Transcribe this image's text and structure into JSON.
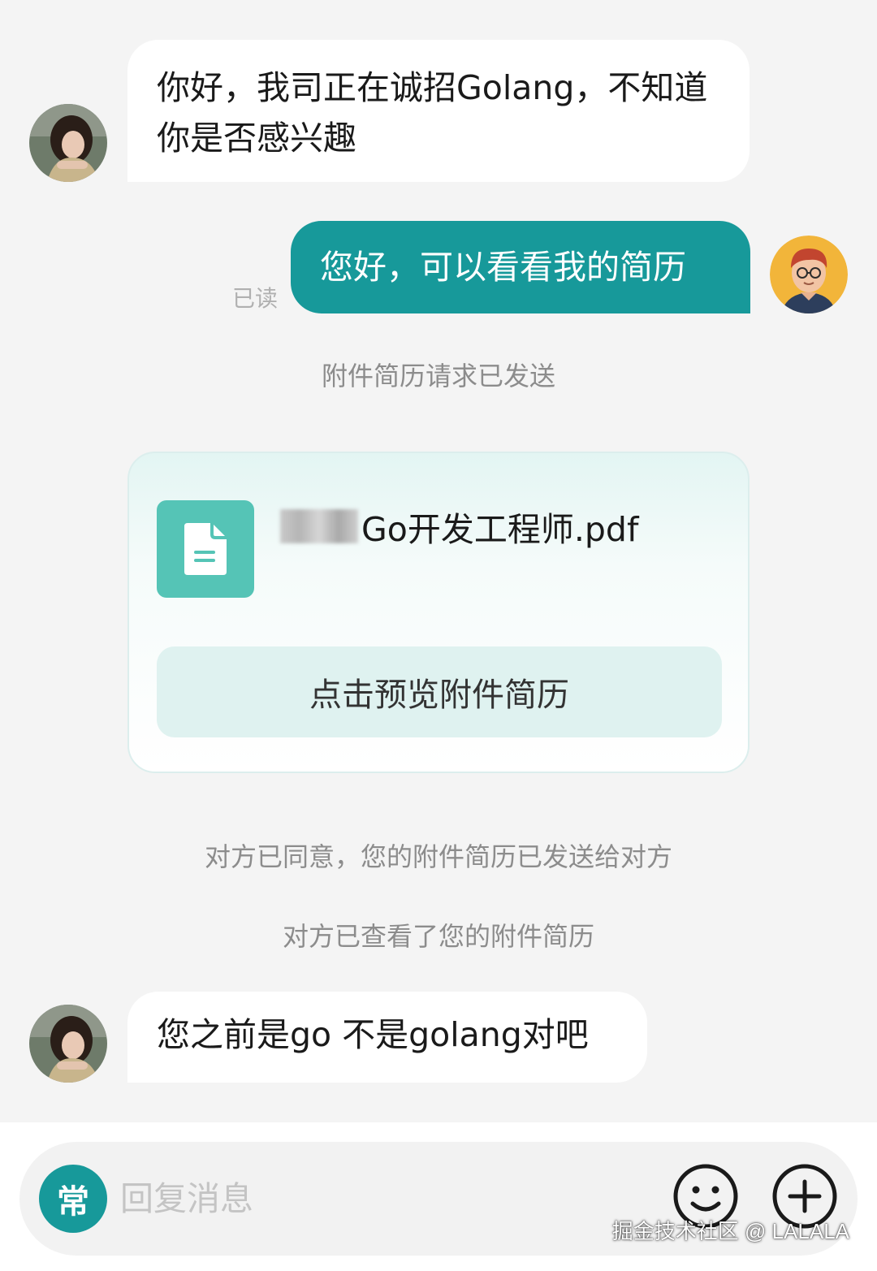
{
  "messages": {
    "m1": {
      "text": "你好，我司正在诚招Golang，不知道你是否感兴趣"
    },
    "m2": {
      "text": "您好，可以看看我的简历",
      "status": "已读"
    },
    "m3": {
      "text": "您之前是go 不是golang对吧"
    }
  },
  "system_notes": {
    "request_sent": "附件简历请求已发送",
    "agreed": "对方已同意，您的附件简历已发送给对方",
    "viewed": "对方已查看了您的附件简历"
  },
  "attachment": {
    "file_name_visible": "Go开发工程师.pdf",
    "preview_label": "点击预览附件简历",
    "icon": "document-icon"
  },
  "input_bar": {
    "quick_phrase_label": "常",
    "placeholder": "回复消息",
    "emoji_icon": "smiley-icon",
    "plus_icon": "plus-icon"
  },
  "watermark": "掘金技术社区 @ LALALA",
  "colors": {
    "accent": "#17999a",
    "file_icon_bg": "#55c4b6",
    "preview_button_bg": "#dff2f0",
    "background": "#f4f4f4"
  }
}
